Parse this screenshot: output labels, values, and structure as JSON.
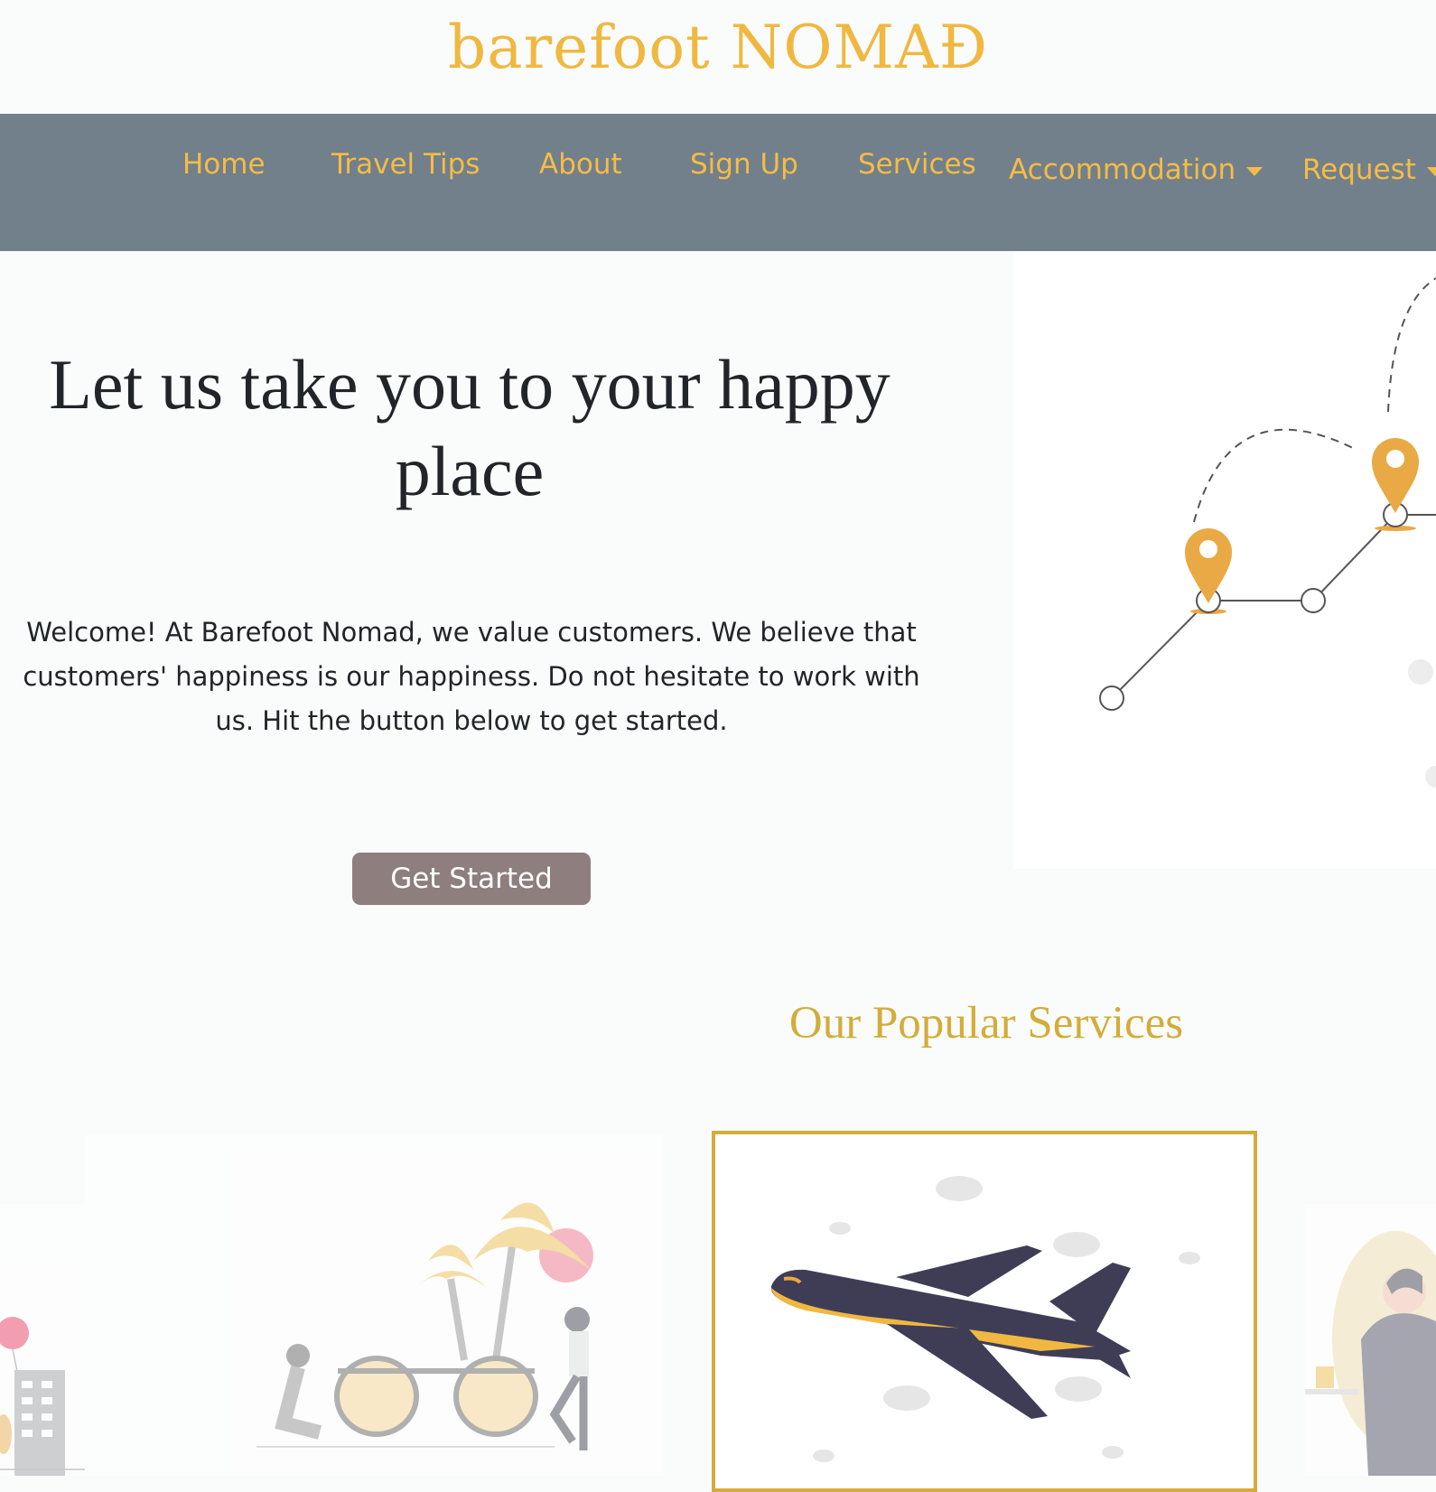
{
  "brand": {
    "name": "barefoot NOMAĐ"
  },
  "nav": {
    "items": [
      {
        "label": "Home"
      },
      {
        "label": "Travel Tips"
      },
      {
        "label": "About"
      },
      {
        "label": "Sign Up"
      },
      {
        "label": "Services"
      },
      {
        "label": "Accommodation",
        "dropdown": true
      },
      {
        "label": "Request",
        "dropdown": true
      }
    ]
  },
  "hero": {
    "title": "Let us take you to your happy place",
    "text": "Welcome! At Barefoot Nomad, we value customers. We believe that customers' happiness is our happiness. Do not hesitate to work with us. Hit the button below to get started.",
    "cta_label": "Get Started"
  },
  "services": {
    "title": "Our Popular Services"
  },
  "colors": {
    "accent": "#f0b840",
    "nav_bg": "#72808c",
    "button_bg": "#8f7e7e",
    "section_title": "#d4ac3a"
  }
}
